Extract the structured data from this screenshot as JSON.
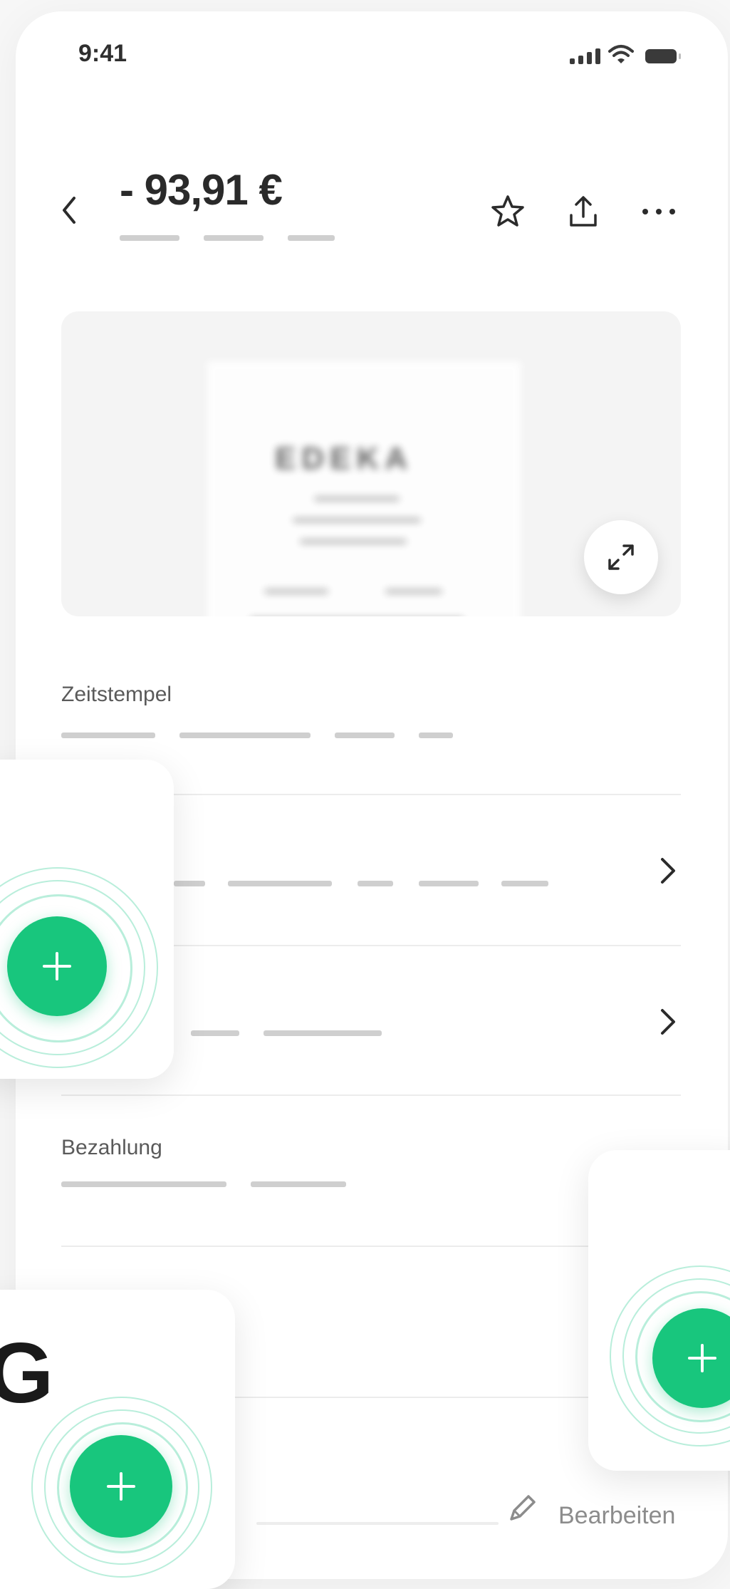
{
  "status_bar": {
    "time": "9:41"
  },
  "header": {
    "amount": "- 93,91 €",
    "icons": [
      "back-chevron-icon",
      "star-icon",
      "share-icon",
      "more-icon"
    ]
  },
  "receipt_preview": {
    "store_text": "EDEKA",
    "expand_icon": "expand-icon"
  },
  "sections": {
    "timestamp_label": "Zeitstempel",
    "payment_label": "Bezahlung"
  },
  "footer": {
    "edit_label": "Bearbeiten"
  },
  "colors": {
    "accent": "#18c67d",
    "text": "#2b2b2b",
    "placeholder": "#cfcfcf",
    "muted": "#8c8c8c"
  }
}
